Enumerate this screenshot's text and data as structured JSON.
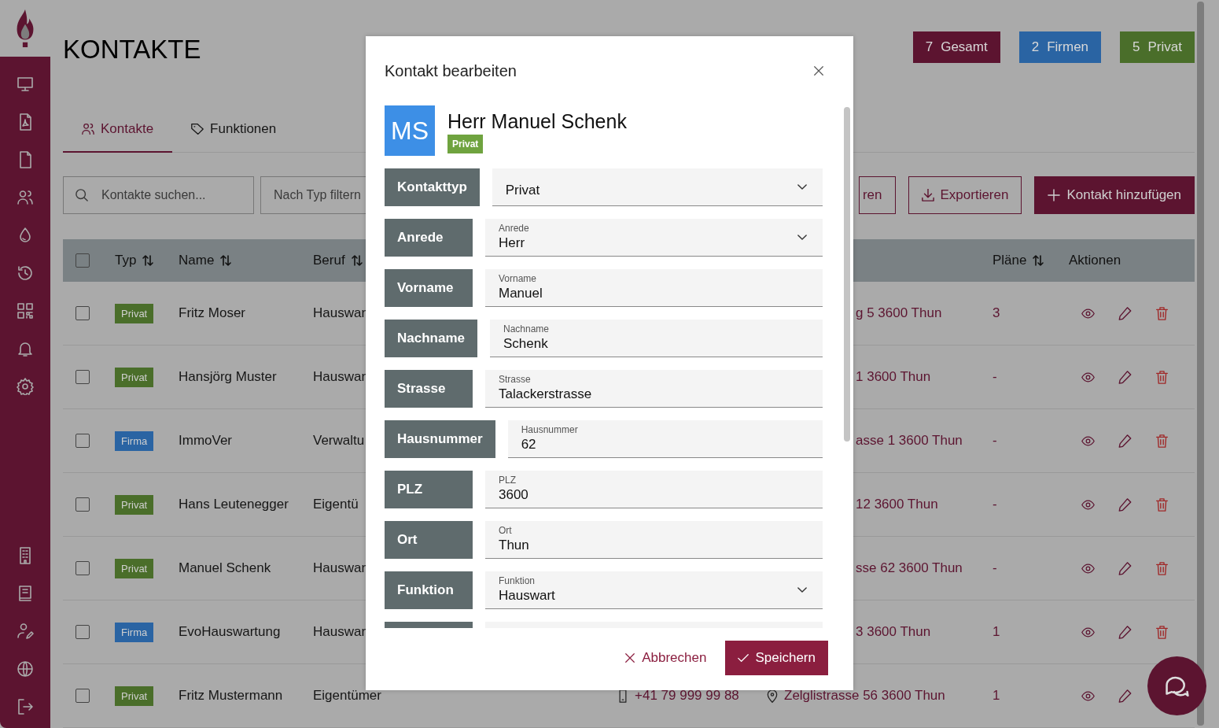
{
  "page": {
    "title": "KONTAKTE"
  },
  "stats": [
    {
      "count": "7",
      "label": "Gesamt",
      "color": "#5c1430"
    },
    {
      "count": "2",
      "label": "Firmen",
      "color": "#2a64a3"
    },
    {
      "count": "5",
      "label": "Privat",
      "color": "#4a6e2a"
    }
  ],
  "tabs": [
    {
      "label": "Kontakte",
      "selected": true
    },
    {
      "label": "Funktionen",
      "selected": false
    }
  ],
  "toolbar": {
    "search": {
      "placeholder": "Kontakte suchen..."
    },
    "filter": {
      "placeholder": "Nach Typ filtern"
    },
    "buttons": [
      {
        "label": "ren",
        "kind": "partial"
      },
      {
        "label": "Exportieren",
        "kind": "export"
      },
      {
        "label": "Kontakt hinzufügen",
        "kind": "add"
      }
    ]
  },
  "table": {
    "select_all": {
      "checked": false
    },
    "columns": [
      {
        "label": "Typ",
        "sortable": true
      },
      {
        "label": "Name",
        "sortable": true
      },
      {
        "label": "Beruf",
        "sortable": true
      },
      {
        "label": "Pläne",
        "sortable": true
      },
      {
        "label": "Aktionen",
        "sortable": false
      }
    ],
    "rows": [
      {
        "checked": false,
        "type": "Privat",
        "color": "#4a6e2a",
        "name": "Fritz Moser",
        "beruf": "Hauswar",
        "address": "g 5 3600 Thun",
        "plaene": "3"
      },
      {
        "checked": false,
        "type": "Privat",
        "color": "#4a6e2a",
        "name": "Hansjörg Muster",
        "beruf": "Hauswar",
        "address": "1 3600 Thun",
        "plaene": "-"
      },
      {
        "checked": false,
        "type": "Firma",
        "color": "#2a64a3",
        "name": "ImmoVer",
        "beruf": "Verwaltu",
        "address": "asse 1 3600 Thun",
        "plaene": "-"
      },
      {
        "checked": false,
        "type": "Privat",
        "color": "#4a6e2a",
        "name": "Hans Leutenegger",
        "beruf": "Eigentü",
        "address": "12 3600 Thun",
        "plaene": "-"
      },
      {
        "checked": false,
        "type": "Privat",
        "color": "#4a6e2a",
        "name": "Manuel Schenk",
        "beruf": "Hauswar",
        "address": "sse 62 3600 Thun",
        "plaene": "-"
      },
      {
        "checked": false,
        "type": "Firma",
        "color": "#2a64a3",
        "name": "EvoHauswartung",
        "beruf": "Hauswar",
        "address": "3 3600 Thun",
        "plaene": "1"
      },
      {
        "checked": false,
        "type": "Privat",
        "color": "#4a6e2a",
        "name": "Fritz Mustermann",
        "beruf": "Eigentümer",
        "phone": "+41 79 999 99 88",
        "address": "Zelglistrasse 56 3600 Thun",
        "plaene": "1"
      }
    ]
  },
  "dialog": {
    "title": "Kontakt bearbeiten",
    "avatar": "MS",
    "name": "Herr Manuel Schenk",
    "badge": {
      "label": "Privat",
      "color": "#6fa33f"
    },
    "fields": [
      {
        "label": "Kontakttyp",
        "kind": "select",
        "value": "Privat"
      },
      {
        "label": "Anrede",
        "kind": "select",
        "caption": "Anrede",
        "value": "Herr"
      },
      {
        "label": "Vorname",
        "kind": "text",
        "caption": "Vorname",
        "value": "Manuel"
      },
      {
        "label": "Nachname",
        "kind": "text",
        "caption": "Nachname",
        "value": "Schenk"
      },
      {
        "label": "Strasse",
        "kind": "text",
        "caption": "Strasse",
        "value": "Talackerstrasse"
      },
      {
        "label": "Hausnummer",
        "kind": "text",
        "caption": "Hausnummer",
        "value": "62"
      },
      {
        "label": "PLZ",
        "kind": "text",
        "caption": "PLZ",
        "value": "3600"
      },
      {
        "label": "Ort",
        "kind": "text",
        "caption": "Ort",
        "value": "Thun"
      },
      {
        "label": "Funktion",
        "kind": "select",
        "caption": "Funktion",
        "value": "Hauswart"
      },
      {
        "kind": "text"
      }
    ],
    "cancel": "Abbrechen",
    "save": "Speichern"
  }
}
